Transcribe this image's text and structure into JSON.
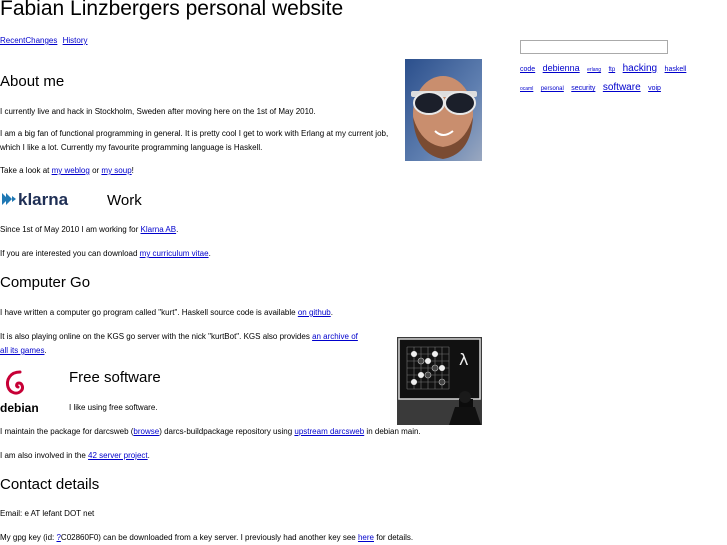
{
  "site": {
    "title": "Fabian Linzbergers personal website"
  },
  "nav": {
    "recent_changes": "RecentChanges",
    "history": "History"
  },
  "about": {
    "heading": "About me",
    "p1": "I currently live and hack in Stockholm, Sweden after moving here on the 1st of May 2010.",
    "p2": "I am a big fan of functional programming in general. It is pretty cool I get to work with Erlang at my current job, which I like a lot. Currently my favourite programming language is Haskell.",
    "p3_pre": "Take a look at ",
    "weblog_link": "my weblog",
    "p3_mid": " or ",
    "soup_link": "my soup",
    "p3_post": "!"
  },
  "work": {
    "logo_text": "klarna",
    "heading": "Work",
    "p1_pre": "Since 1st of May 2010 I am working for ",
    "klarna_link": "Klarna AB",
    "p1_post": ".",
    "p2_pre": "If you are interested you can download ",
    "cv_link": "my curriculum vitae",
    "p2_post": "."
  },
  "go": {
    "heading": "Computer Go",
    "p1_pre": "I have written a computer go program called \"kurt\". Haskell source code is available ",
    "github_link": "on github",
    "p1_post": ".",
    "p2_pre": "It is also playing online on the KGS go server with the nick \"kurtBot\". KGS also provides ",
    "archive_link_1": "an archive of",
    "archive_link_2": "all its games",
    "p2_post": "."
  },
  "freesw": {
    "logo_text": "debian",
    "heading": "Free software",
    "p1": "I like using free software.",
    "p2_pre": "I maintain the package for darcsweb (",
    "browse_link": "browse",
    "p2_mid": ") darcs-buildpackage repository using ",
    "upstream_link": "upstream darcsweb",
    "p2_post": " in debian main.",
    "p3_pre": "I am also involved in the ",
    "project_link": "42 server project",
    "p3_post": "."
  },
  "contact": {
    "heading": "Contact details",
    "email": "Email: e AT lefant DOT net",
    "gpg_pre": "My gpg key (id: ",
    "gpg_link": "?",
    "gpg_mid": "C02860F0) can be downloaded from a key server. I previously had another key see ",
    "here_link": "here",
    "gpg_post": " for details."
  },
  "sidebar": {
    "search_placeholder": "",
    "tags": [
      {
        "label": "code",
        "size": "7px"
      },
      {
        "label": "debienna",
        "size": "9px"
      },
      {
        "label": "erlang",
        "size": "5px"
      },
      {
        "label": "ftp",
        "size": "6px"
      },
      {
        "label": "hacking",
        "size": "10px"
      },
      {
        "label": "haskell",
        "size": "7px"
      },
      {
        "label": "ocaml",
        "size": "5px"
      },
      {
        "label": "personal",
        "size": "6px"
      },
      {
        "label": "security",
        "size": "7px"
      },
      {
        "label": "software",
        "size": "10px"
      },
      {
        "label": "voip",
        "size": "7px"
      }
    ]
  },
  "images": {
    "go_board_glyph": "λ"
  }
}
